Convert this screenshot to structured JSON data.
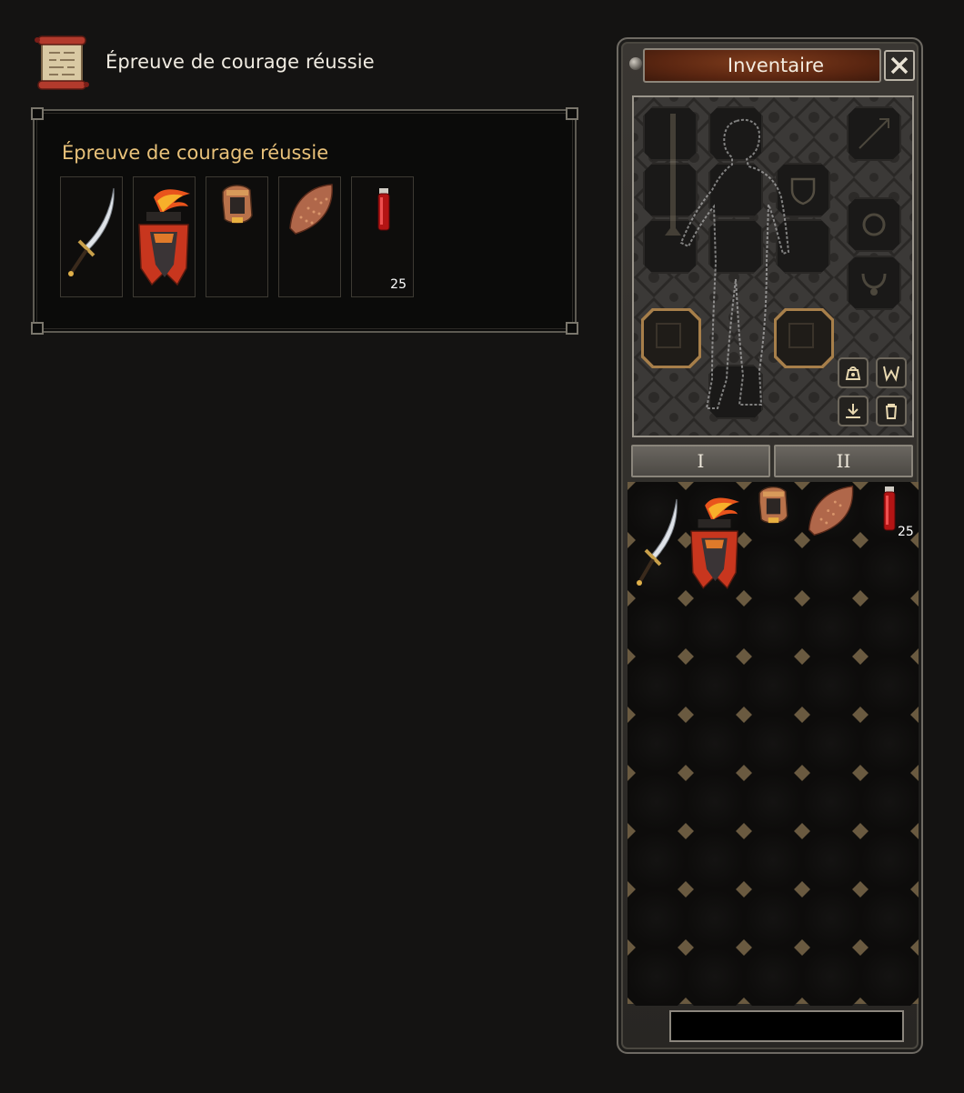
{
  "quest": {
    "header_title": "Épreuve de courage réussie",
    "panel_title": "Épreuve de courage réussie",
    "rewards": [
      {
        "icon": "sword-icon",
        "quantity": ""
      },
      {
        "icon": "flame-armor-icon",
        "quantity": ""
      },
      {
        "icon": "helmet-icon",
        "quantity": ""
      },
      {
        "icon": "shield-icon",
        "quantity": ""
      },
      {
        "icon": "red-potion-icon",
        "quantity": "25"
      }
    ]
  },
  "inventory": {
    "title": "Inventaire",
    "close_glyph": "✕",
    "tabs": [
      "I",
      "II"
    ],
    "potion_quantity": "25",
    "grid_columns": 5,
    "grid_rows": 9
  },
  "colors": {
    "title_bar": "#5b2611",
    "panel_title": "#e9c27a",
    "frame_gold": "#a77f4a"
  }
}
